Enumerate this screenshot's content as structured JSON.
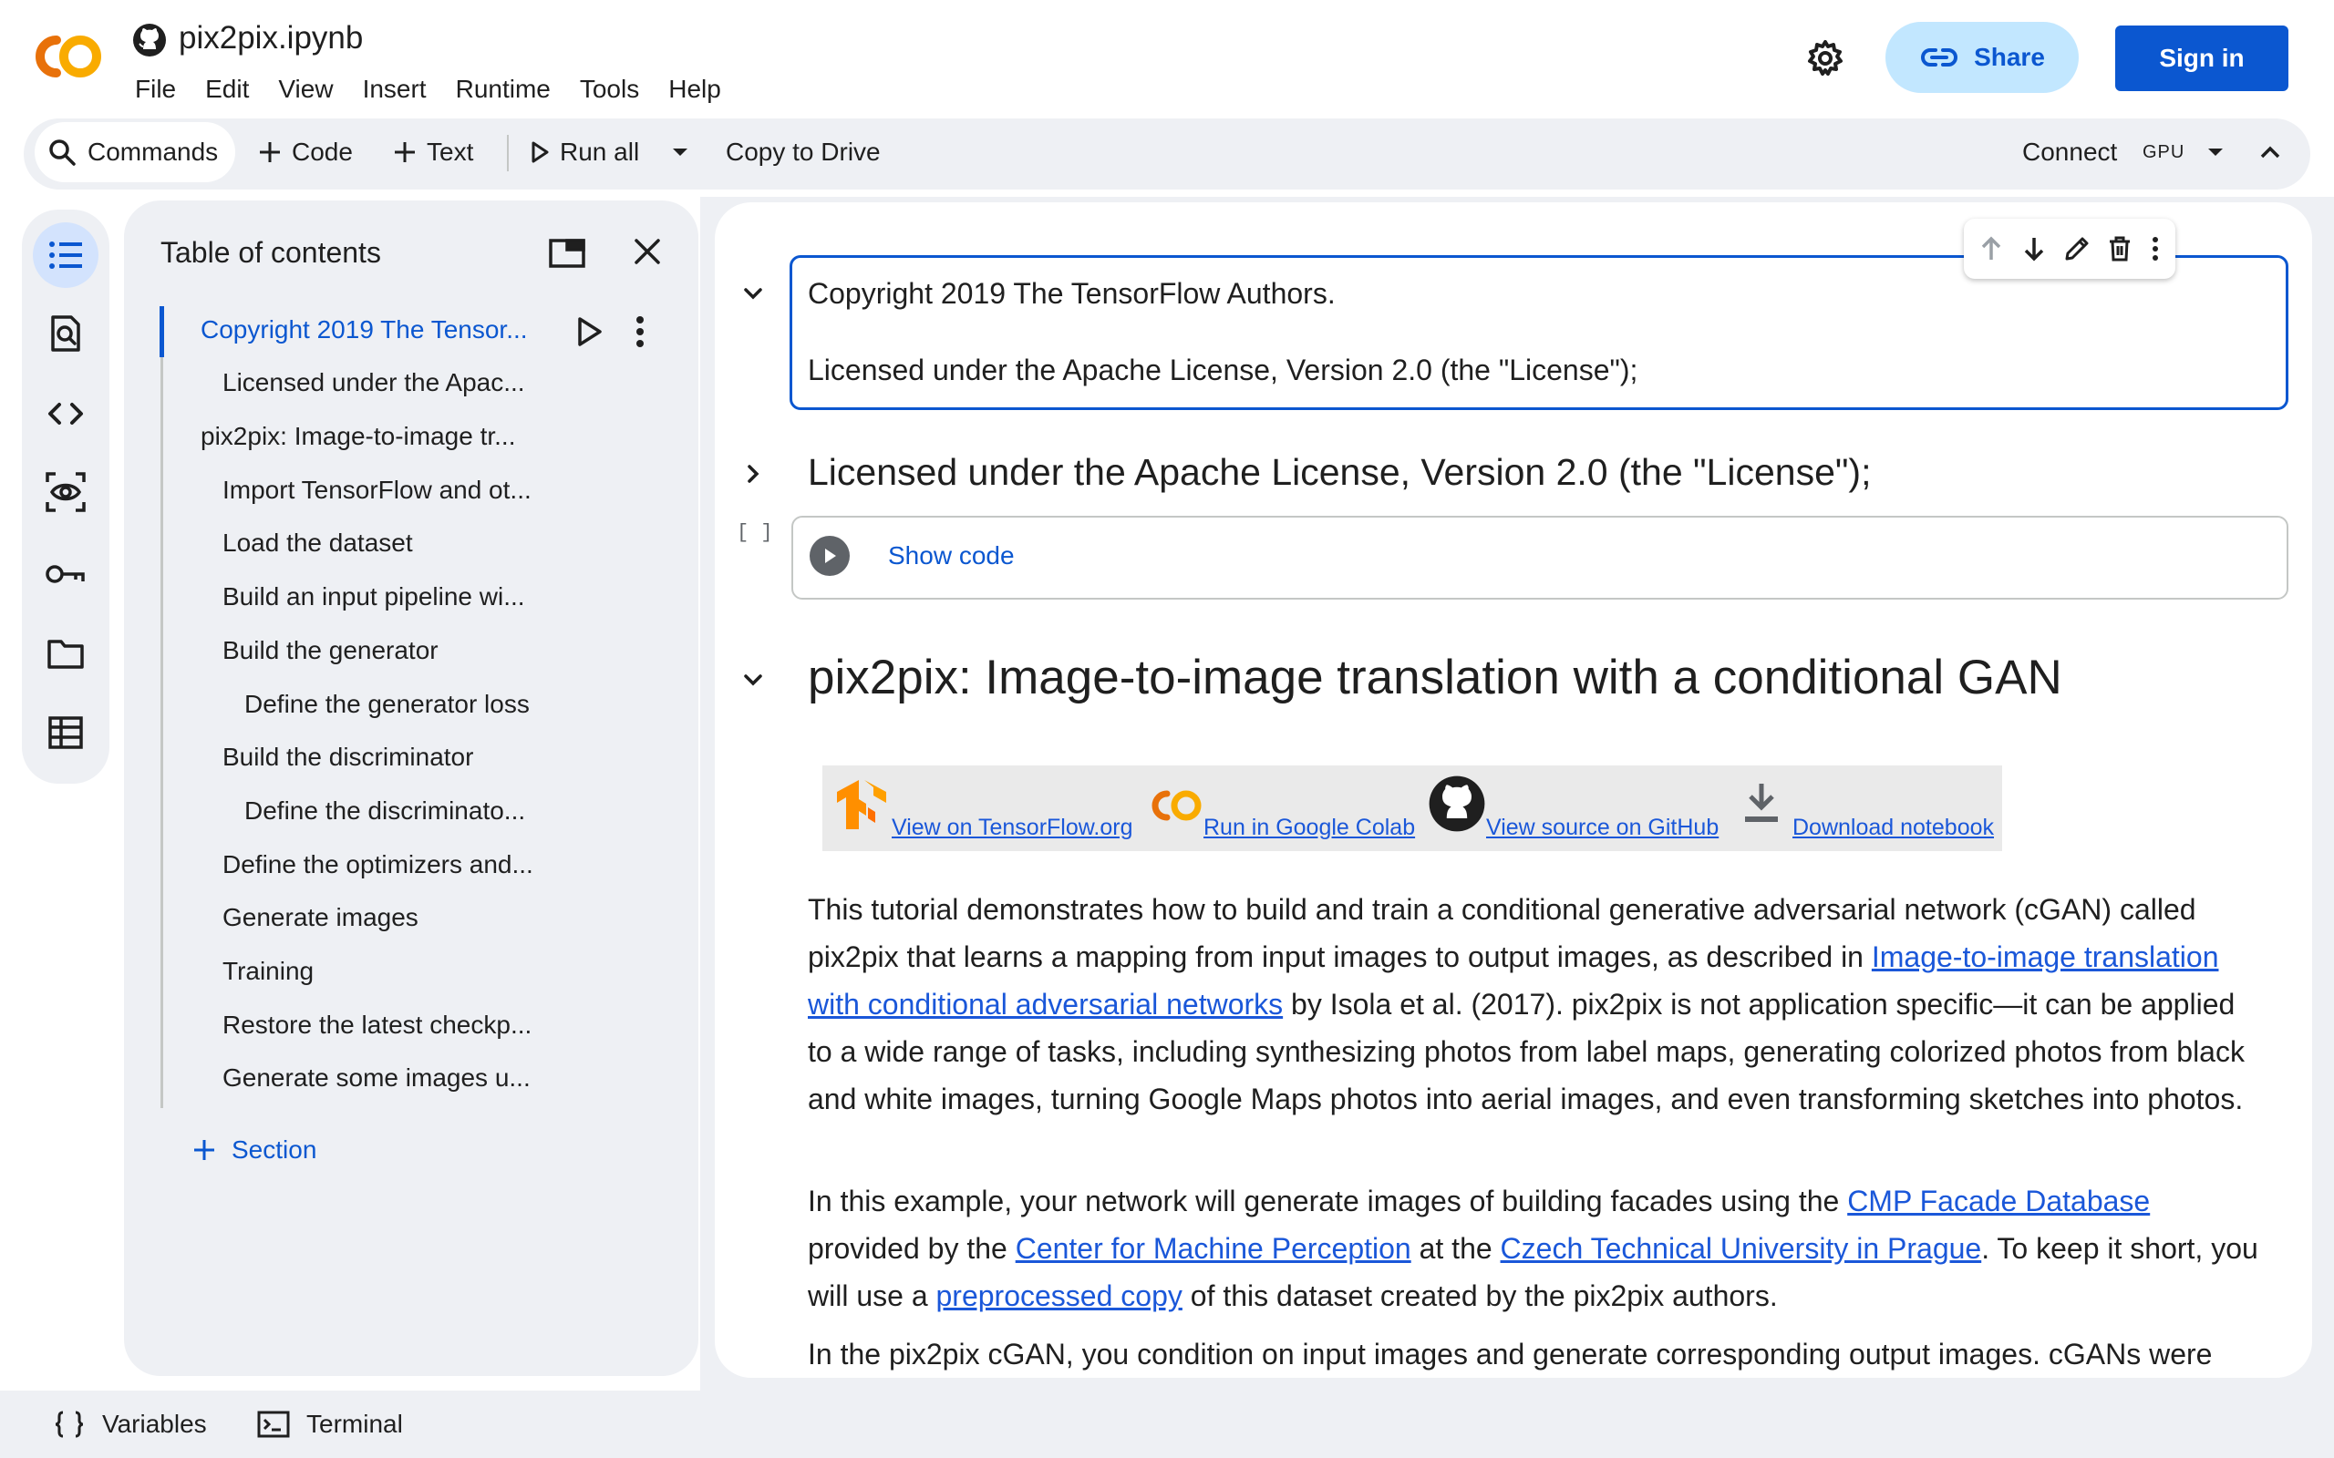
{
  "header": {
    "notebook_title": "pix2pix.ipynb",
    "menu": [
      "File",
      "Edit",
      "View",
      "Insert",
      "Runtime",
      "Tools",
      "Help"
    ],
    "share_label": "Share",
    "signin_label": "Sign in"
  },
  "toolbar": {
    "commands_label": "Commands",
    "code_label": "Code",
    "text_label": "Text",
    "run_all_label": "Run all",
    "copy_to_drive_label": "Copy to Drive",
    "connect_label": "Connect",
    "gpu_label": "GPU"
  },
  "toc": {
    "title": "Table of contents",
    "items": [
      "Copyright 2019 The Tensor...",
      "Licensed under the Apac...",
      "pix2pix: Image-to-image tr...",
      "Import TensorFlow and ot...",
      "Load the dataset",
      "Build an input pipeline wi...",
      "Build the generator",
      "Define the generator loss",
      "Build the discriminator",
      "Define the discriminato...",
      "Define the optimizers and...",
      "Generate images",
      "Training",
      "Restore the latest checkp...",
      "Generate some images u..."
    ],
    "add_section_label": "Section"
  },
  "cells": {
    "cell1_line1": "Copyright 2019 The TensorFlow Authors.",
    "cell1_line2": "Licensed under the Apache License, Version 2.0 (the \"License\");",
    "heading2": "Licensed under the Apache License, Version 2.0 (the \"License\");",
    "code_bracket": "[ ]",
    "show_code_label": "Show code",
    "heading1": "pix2pix: Image-to-image translation with a conditional GAN",
    "badges": [
      "View on TensorFlow.org",
      "Run in Google Colab",
      "View source on GitHub",
      "Download notebook"
    ],
    "para1": {
      "t1": "This tutorial demonstrates how to build and train a conditional generative adversarial network (cGAN) called pix2pix that learns a mapping from input images to output images, as described in ",
      "link1": "Image-to-image translation with conditional adversarial networks",
      "t2": " by Isola et al. (2017). pix2pix is not application specific—it can be applied to a wide range of tasks, including synthesizing photos from label maps, generating colorized photos from black and white images, turning Google Maps photos into aerial images, and even transforming sketches into photos."
    },
    "para2": {
      "t1": "In this example, your network will generate images of building facades using the ",
      "link1": "CMP Facade Database",
      "t2": " provided by the ",
      "link2": "Center for Machine Perception",
      "t3": " at the ",
      "link3": "Czech Technical University in Prague",
      "t4": ". To keep it short, you will use a ",
      "link4": "preprocessed copy",
      "t5": " of this dataset created by the pix2pix authors."
    },
    "para3": "In the pix2pix cGAN, you condition on input images and generate corresponding output images. cGANs were"
  },
  "bottom": {
    "variables_label": "Variables",
    "terminal_label": "Terminal"
  },
  "colors": {
    "accent": "#0b57d0",
    "link": "#1a57d9",
    "panel": "#eef0f4",
    "colab_orange": "#f9ab00"
  }
}
